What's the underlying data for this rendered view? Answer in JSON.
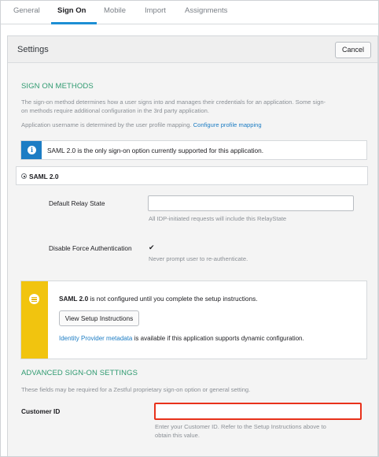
{
  "tabs": [
    {
      "label": "General"
    },
    {
      "label": "Sign On"
    },
    {
      "label": "Mobile"
    },
    {
      "label": "Import"
    },
    {
      "label": "Assignments"
    }
  ],
  "settings": {
    "title": "Settings",
    "cancel_label": "Cancel"
  },
  "sign_on_methods": {
    "heading": "SIGN ON METHODS",
    "desc_line1": "The sign-on method determines how a user signs into and manages their credentials for an application. Some sign-",
    "desc_line2": "on methods require additional configuration in the 3rd party application.",
    "username_text": "Application username is determined by the user profile mapping.",
    "username_link": "Configure profile mapping",
    "info_note": "SAML 2.0 is the only sign-on option currently supported for this application."
  },
  "saml": {
    "label": "SAML 2.0",
    "relay_state_label": "Default Relay State",
    "relay_state_value": "",
    "relay_state_help": "All IDP-initiated requests will include this RelayState",
    "force_auth_label": "Disable Force Authentication",
    "force_auth_checked": true,
    "force_auth_help": "Never prompt user to re-authenticate."
  },
  "setup_note": {
    "bold": "SAML 2.0",
    "text": " is not configured until you complete the setup instructions.",
    "button_label": "View Setup Instructions",
    "metadata_link": "Identity Provider metadata",
    "metadata_text": " is available if this application supports dynamic configuration."
  },
  "advanced": {
    "heading": "ADVANCED SIGN-ON SETTINGS",
    "desc": "These fields may be required for a Zestful proprietary sign-on option or general setting.",
    "customer_id_label": "Customer ID",
    "customer_id_value": "",
    "customer_id_help_line1": "Enter your Customer ID. Refer to the Setup Instructions above to",
    "customer_id_help_line2": "obtain this value."
  },
  "colors": {
    "accent": "#1d8fd4",
    "section_heading": "#2f9a70",
    "info": "#1d7dc4",
    "warning": "#f1c40f",
    "highlight": "#e8321b"
  },
  "icons": {
    "info": "info-icon",
    "warning": "list-icon"
  }
}
